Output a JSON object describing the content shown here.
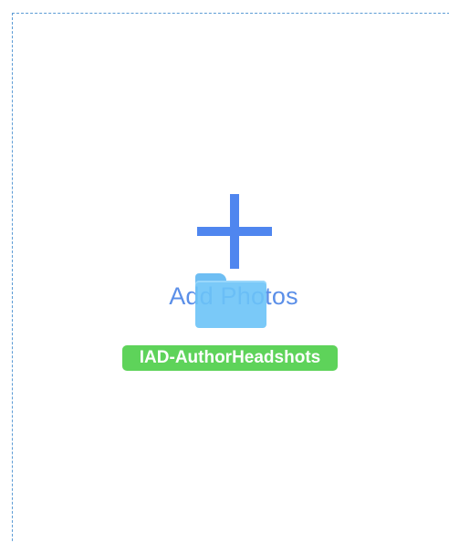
{
  "dropzone": {
    "add_label": "Add Photos",
    "plus_icon": "plus-icon"
  },
  "drag": {
    "folder_icon": "folder-icon",
    "folder_name": "IAD-AuthorHeadshots"
  },
  "colors": {
    "accent_blue": "#4f86ef",
    "dash_border": "#5b9bd5",
    "badge_green": "#5ed35a",
    "folder_blue": "#6cc4f8"
  }
}
